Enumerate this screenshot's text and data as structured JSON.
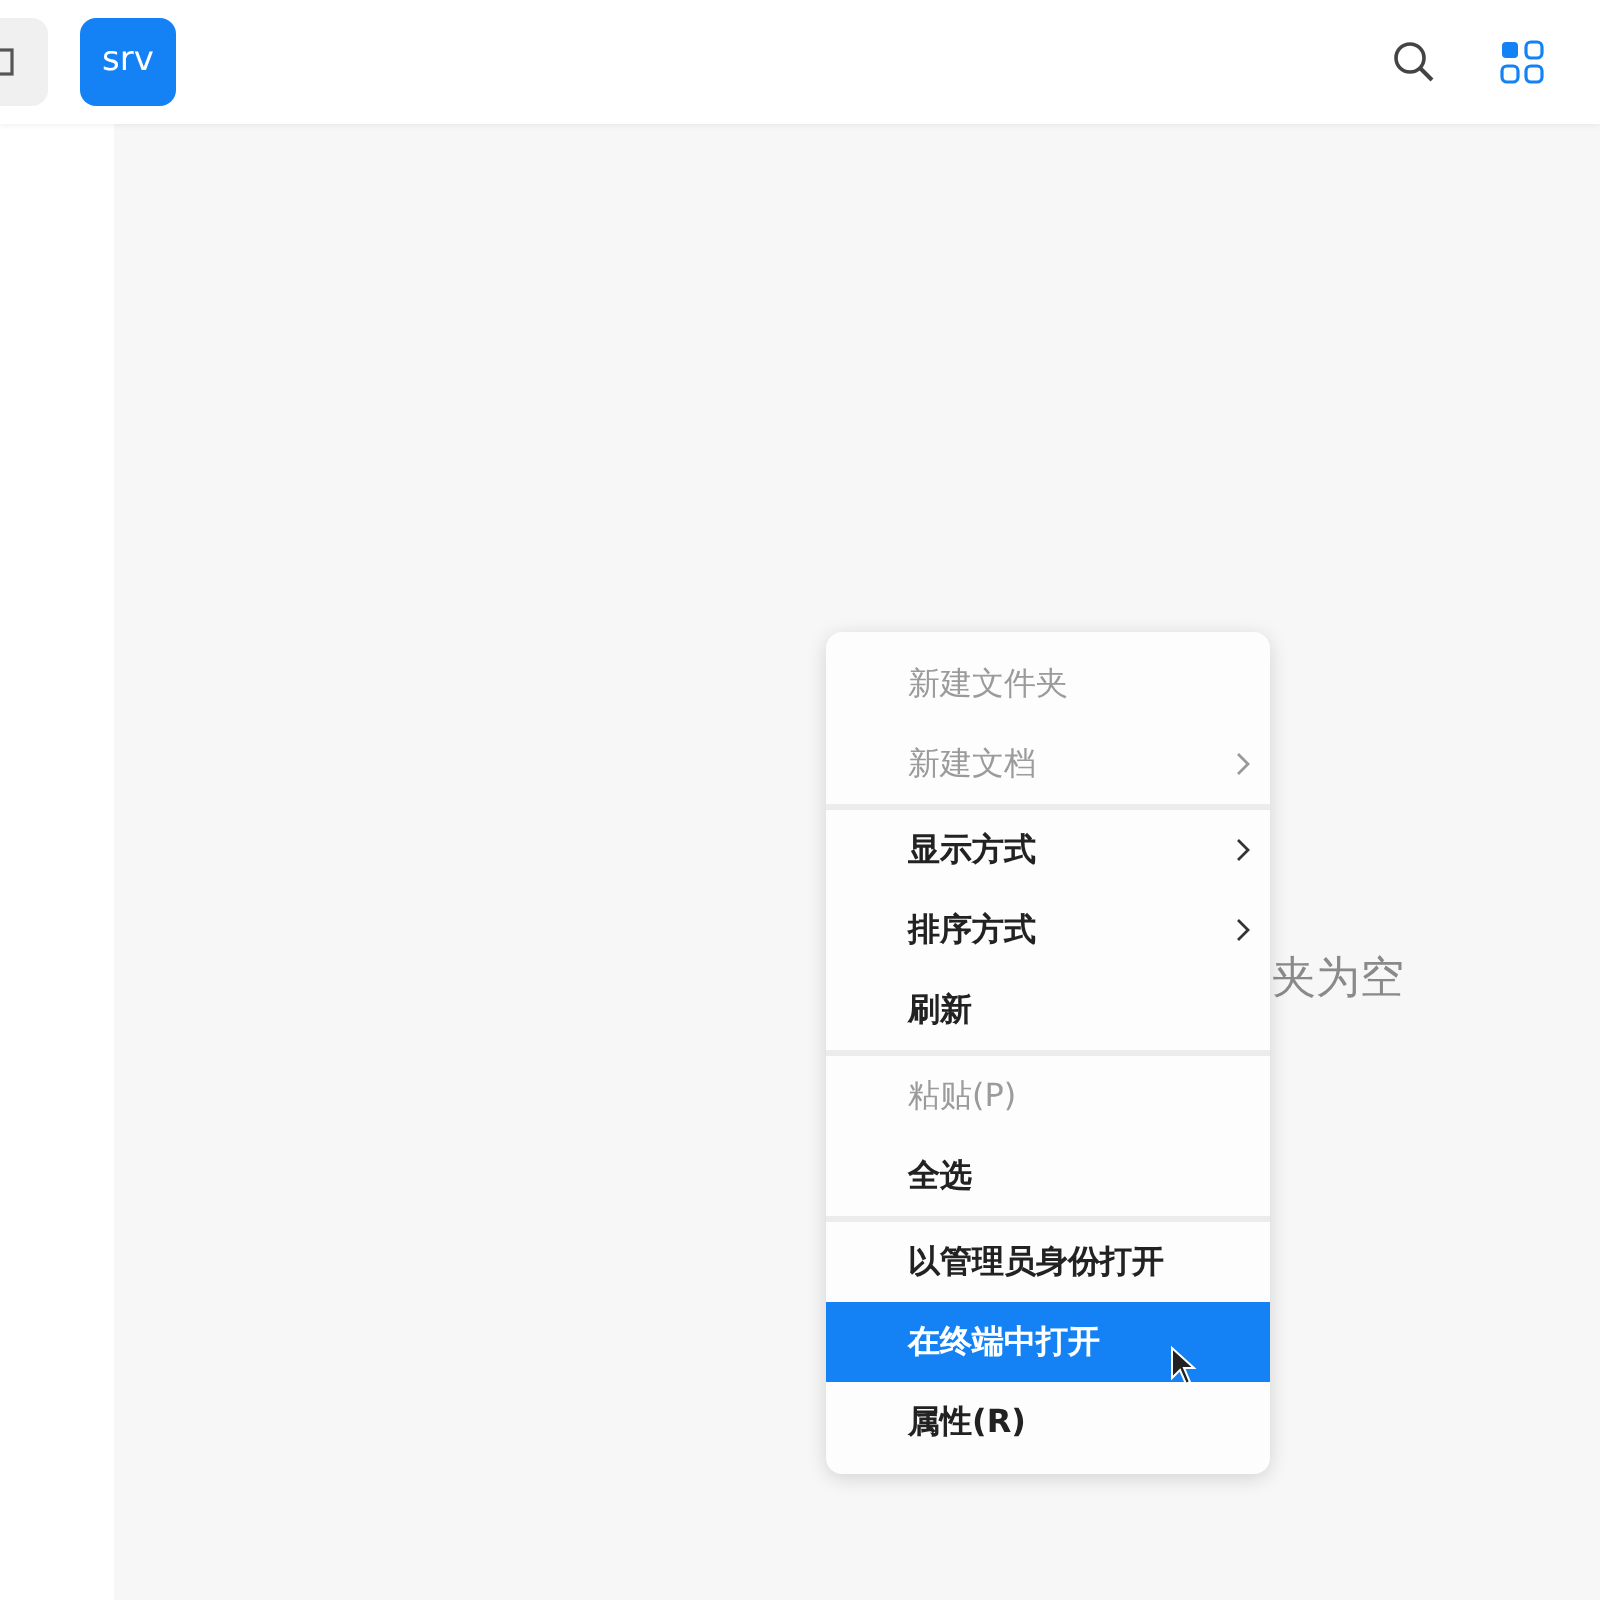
{
  "toolbar": {
    "path_button": "srv"
  },
  "empty_message": "夹为空",
  "context_menu": {
    "groups": [
      [
        {
          "label": "新建文件夹",
          "disabled": true,
          "submenu": false,
          "selected": false
        },
        {
          "label": "新建文档",
          "disabled": true,
          "submenu": true,
          "selected": false
        }
      ],
      [
        {
          "label": "显示方式",
          "disabled": false,
          "submenu": true,
          "selected": false
        },
        {
          "label": "排序方式",
          "disabled": false,
          "submenu": true,
          "selected": false
        },
        {
          "label": "刷新",
          "disabled": false,
          "submenu": false,
          "selected": false
        }
      ],
      [
        {
          "label": "粘贴(P)",
          "disabled": true,
          "submenu": false,
          "selected": false
        },
        {
          "label": "全选",
          "disabled": false,
          "submenu": false,
          "selected": false
        }
      ],
      [
        {
          "label": "以管理员身份打开",
          "disabled": false,
          "submenu": false,
          "selected": false
        },
        {
          "label": "在终端中打开",
          "disabled": false,
          "submenu": false,
          "selected": true
        },
        {
          "label": "属性(R)",
          "disabled": false,
          "submenu": false,
          "selected": false
        }
      ]
    ]
  }
}
